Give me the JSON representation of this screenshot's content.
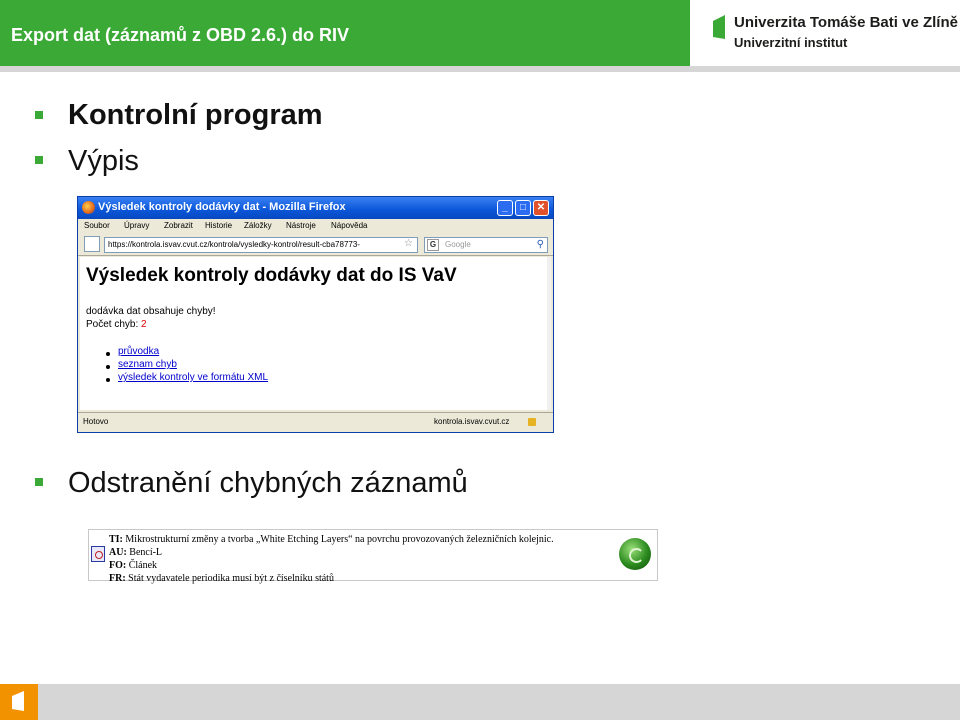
{
  "header": {
    "title": "Export dat (záznamů z OBD 2.6.) do RIV",
    "logo": {
      "line1": "Univerzita Tomáše Bati ve Zlíně",
      "line2": "Univerzitní institut"
    }
  },
  "bullets": [
    {
      "label": "Kontrolní program"
    },
    {
      "label": "Výpis"
    },
    {
      "label": "Odstranění chybných záznamů"
    }
  ],
  "browser": {
    "window_title": "Výsledek kontroly dodávky dat - Mozilla Firefox",
    "menu": [
      "Soubor",
      "Úpravy",
      "Zobrazit",
      "Historie",
      "Záložky",
      "Nástroje",
      "Nápověda"
    ],
    "url": "https://kontrola.isvav.cvut.cz/kontrola/vysledky-kontrol/result-cba78773-",
    "search_placeholder": "Google",
    "heading": "Výsledek kontroly dodávky dat do IS VaV",
    "message": "dodávka dat obsahuje chyby!",
    "error_count_label": "Počet chyb:",
    "error_count": "2",
    "links": [
      "průvodka",
      "seznam chyb",
      "výsledek kontroly ve formátu XML"
    ],
    "status_left": "Hotovo",
    "status_right": "kontrola.isvav.cvut.cz"
  },
  "record": {
    "rows": [
      {
        "key": "TI:",
        "value": "Mikrostrukturní změny a tvorba „White Etching Layers“ na povrchu provozovaných železničních kolejnic."
      },
      {
        "key": "AU:",
        "value": "Bencí-L"
      },
      {
        "key": "FO:",
        "value": "Článek"
      },
      {
        "key": "FR:",
        "value": "Stát vydavatele periodika musí být z číselníku států"
      }
    ]
  },
  "colors": {
    "accent_green": "#3aa935",
    "footer_orange": "#f39200",
    "gray_band": "#d6d6d6"
  }
}
